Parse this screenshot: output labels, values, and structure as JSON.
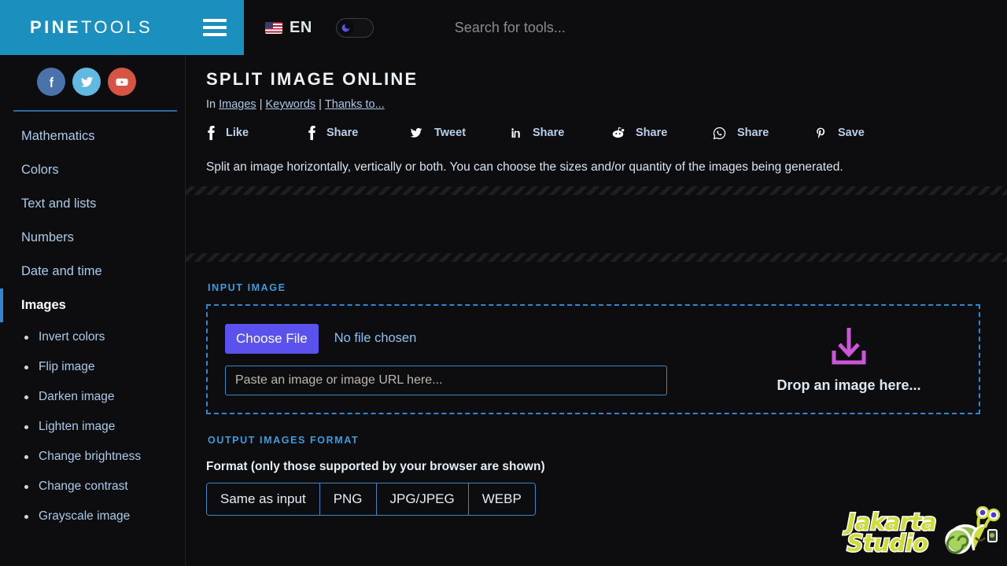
{
  "header": {
    "logo_bold": "PINE",
    "logo_light": "TOOLS",
    "menu_icon": "hamburger-icon",
    "language": "EN",
    "flag_icon": "us-flag-icon",
    "theme_toggle_icon": "moon-icon",
    "search_placeholder": "Search for tools...",
    "search_value": ""
  },
  "sidebar": {
    "socials": [
      {
        "name": "facebook",
        "label": "f"
      },
      {
        "name": "twitter",
        "label": "t"
      },
      {
        "name": "youtube",
        "label": "y"
      }
    ],
    "categories": [
      {
        "label": "Mathematics",
        "active": false
      },
      {
        "label": "Colors",
        "active": false
      },
      {
        "label": "Text and lists",
        "active": false
      },
      {
        "label": "Numbers",
        "active": false
      },
      {
        "label": "Date and time",
        "active": false
      },
      {
        "label": "Images",
        "active": true
      }
    ],
    "image_tools": [
      {
        "label": "Invert colors"
      },
      {
        "label": "Flip image"
      },
      {
        "label": "Darken image"
      },
      {
        "label": "Lighten image"
      },
      {
        "label": "Change brightness"
      },
      {
        "label": "Change contrast"
      },
      {
        "label": "Grayscale image"
      }
    ]
  },
  "main": {
    "title": "SPLIT IMAGE ONLINE",
    "breadcrumb": {
      "prefix": "In",
      "links": [
        "Images",
        "Keywords",
        "Thanks to..."
      ],
      "separator": "|"
    },
    "share_buttons": [
      {
        "network": "facebook-like",
        "icon": "facebook-icon",
        "label": "Like"
      },
      {
        "network": "facebook-share",
        "icon": "facebook-icon",
        "label": "Share"
      },
      {
        "network": "twitter",
        "icon": "twitter-icon",
        "label": "Tweet"
      },
      {
        "network": "linkedin",
        "icon": "linkedin-icon",
        "label": "Share"
      },
      {
        "network": "reddit",
        "icon": "reddit-icon",
        "label": "Share"
      },
      {
        "network": "whatsapp",
        "icon": "whatsapp-icon",
        "label": "Share"
      },
      {
        "network": "pinterest",
        "icon": "pinterest-icon",
        "label": "Save"
      }
    ],
    "description": "Split an image horizontally, vertically or both. You can choose the sizes and/or quantity of the images being generated.",
    "input_section": {
      "label": "INPUT IMAGE",
      "choose_file_label": "Choose File",
      "file_status": "No file chosen",
      "url_placeholder": "Paste an image or image URL here...",
      "url_value": "",
      "drop_text": "Drop an image here...",
      "drop_icon": "download-arrow-icon"
    },
    "output_section": {
      "label": "OUTPUT IMAGES FORMAT",
      "format_label": "Format (only those supported by your browser are shown)",
      "formats": [
        {
          "label": "Same as input"
        },
        {
          "label": "PNG"
        },
        {
          "label": "JPG/JPEG"
        },
        {
          "label": "WEBP"
        }
      ]
    }
  },
  "watermark": {
    "line1": "Jakarta",
    "line2": "Studio",
    "mascot_icon": "snail-icon"
  },
  "colors": {
    "brand_blue": "#1b8fbe",
    "accent_blue": "#2e86d4",
    "link_blue": "#a8c8e8",
    "choose_file_purple": "#5b52ee",
    "drop_arrow_magenta": "#cc55d8",
    "background": "#0d0d0f",
    "watermark_green": "#cddd3a"
  }
}
